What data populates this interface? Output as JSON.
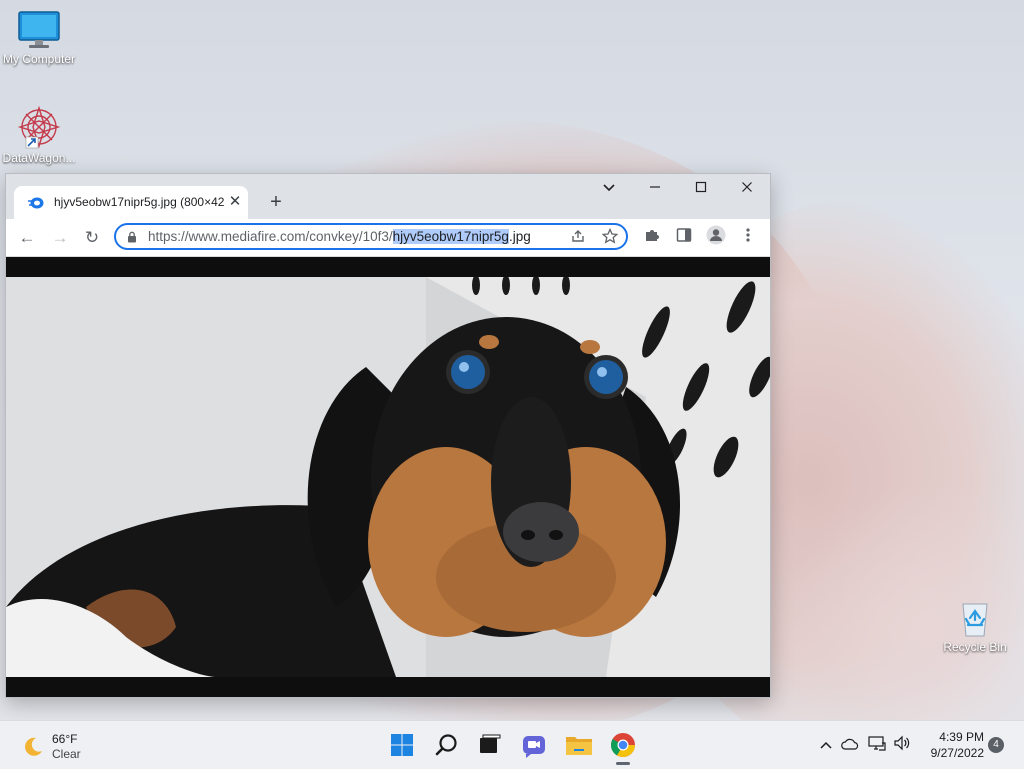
{
  "desktop": {
    "icons": [
      {
        "label": "My Computer",
        "icon": "monitor-icon"
      },
      {
        "label": "DataWagon...",
        "icon": "datawagon-shortcut-icon"
      },
      {
        "label": "Recycle Bin",
        "icon": "recycle-bin-icon"
      }
    ]
  },
  "browser": {
    "tab": {
      "title": "hjyv5eobw17nipr5g.jpg (800×42",
      "close_glyph": "✕"
    },
    "new_tab_glyph": "+",
    "window_controls": {
      "dropdown": "⌄",
      "minimize": "—",
      "maximize": "▢",
      "close": "✕"
    },
    "nav": {
      "back": "←",
      "forward": "→",
      "reload": "↻"
    },
    "address": {
      "prefix": "https://www.mediafire.com/convkey/10f3/",
      "selected": "hjyv5eobw17nipr5g",
      "suffix": ".jpg"
    },
    "toolbar_icons": [
      "share-icon",
      "bookmark-star-icon",
      "extensions-icon",
      "side-panel-icon",
      "profile-icon",
      "menu-icon"
    ],
    "content": {
      "image_description_icon": "dog-photo-icon"
    }
  },
  "taskbar": {
    "weather": {
      "temp": "66°F",
      "condition": "Clear"
    },
    "apps": [
      "start-icon",
      "search-icon",
      "task-view-icon",
      "chat-icon",
      "file-explorer-icon",
      "chrome-icon"
    ],
    "tray": [
      "chevron-up-icon",
      "onedrive-cloud-icon",
      "network-icon",
      "volume-icon"
    ],
    "time": "4:39 PM",
    "date": "9/27/2022",
    "notification_count": "4"
  },
  "colors": {
    "accent": "#1a73e8",
    "selection": "#aecbfa",
    "taskbar": "#eef0f4"
  }
}
